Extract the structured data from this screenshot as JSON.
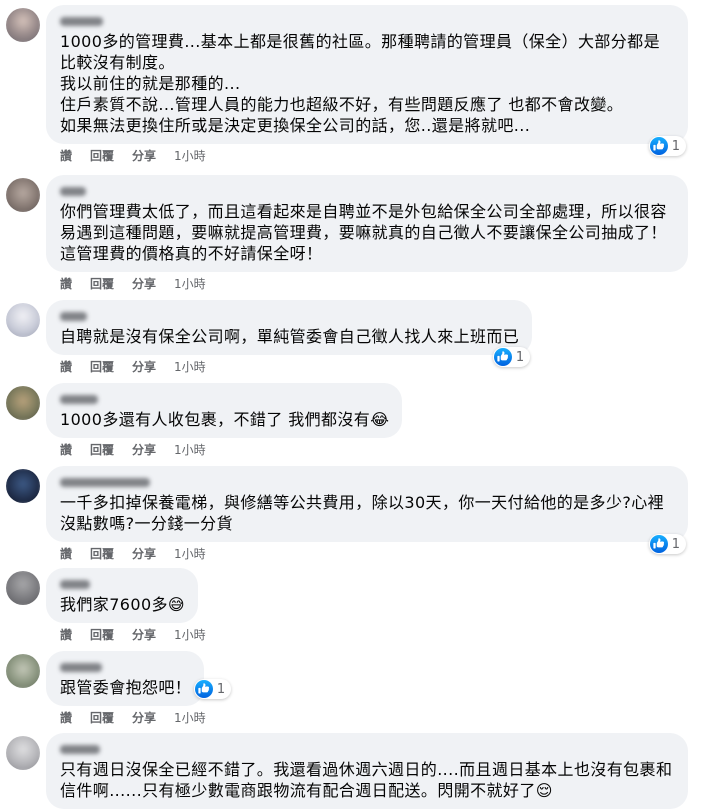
{
  "actions": {
    "like": "讚",
    "reply": "回覆",
    "share": "分享"
  },
  "colors": {
    "bubble_bg": "#f0f2f5",
    "action_text": "#65676b",
    "like_blue": "#1877f2"
  },
  "comments": [
    {
      "paragraphs": [
        "1000多的管理費...基本上都是很舊的社區。那種聘請的管理員（保全）大部分都是比較沒有制度。",
        "我以前住的就是那種的...",
        "住戶素質不說...管理人員的能力也超級不好，有些問題反應了 也都不會改變。",
        "如果無法更換住所或是決定更換保全公司的話，您..還是將就吧..."
      ],
      "time": "1小時",
      "reactions": "1"
    },
    {
      "paragraphs": [
        "你們管理費太低了，而且這看起來是自聘並不是外包給保全公司全部處理，所以很容易遇到這種問題，要嘛就提高管理費，要嘛就真的自己徵人不要讓保全公司抽成了！這管理費的價格真的不好請保全呀！"
      ],
      "time": "1小時"
    },
    {
      "paragraphs": [
        "自聘就是沒有保全公司啊，單純管委會自己徵人找人來上班而已"
      ],
      "time": "1小時",
      "reactions": "1"
    },
    {
      "paragraphs": [
        "1000多還有人收包裹，不錯了 我們都沒有😂"
      ],
      "time": "1小時"
    },
    {
      "paragraphs": [
        "一千多扣掉保養電梯，與修繕等公共費用，除以30天，你一天付給他的是多少?心裡沒點數嗎?一分錢一分貨"
      ],
      "time": "1小時",
      "reactions": "1"
    },
    {
      "paragraphs": [
        "我們家7600多😅"
      ],
      "time": "1小時"
    },
    {
      "paragraphs": [
        "跟管委會抱怨吧！"
      ],
      "time": "1小時",
      "reactions": "1"
    },
    {
      "paragraphs": [
        "只有週日沒保全已經不錯了。我還看過休週六週日的....而且週日基本上也沒有包裹和信件啊......只有極少數電商跟物流有配合週日配送。閃開不就好了😌"
      ]
    }
  ]
}
